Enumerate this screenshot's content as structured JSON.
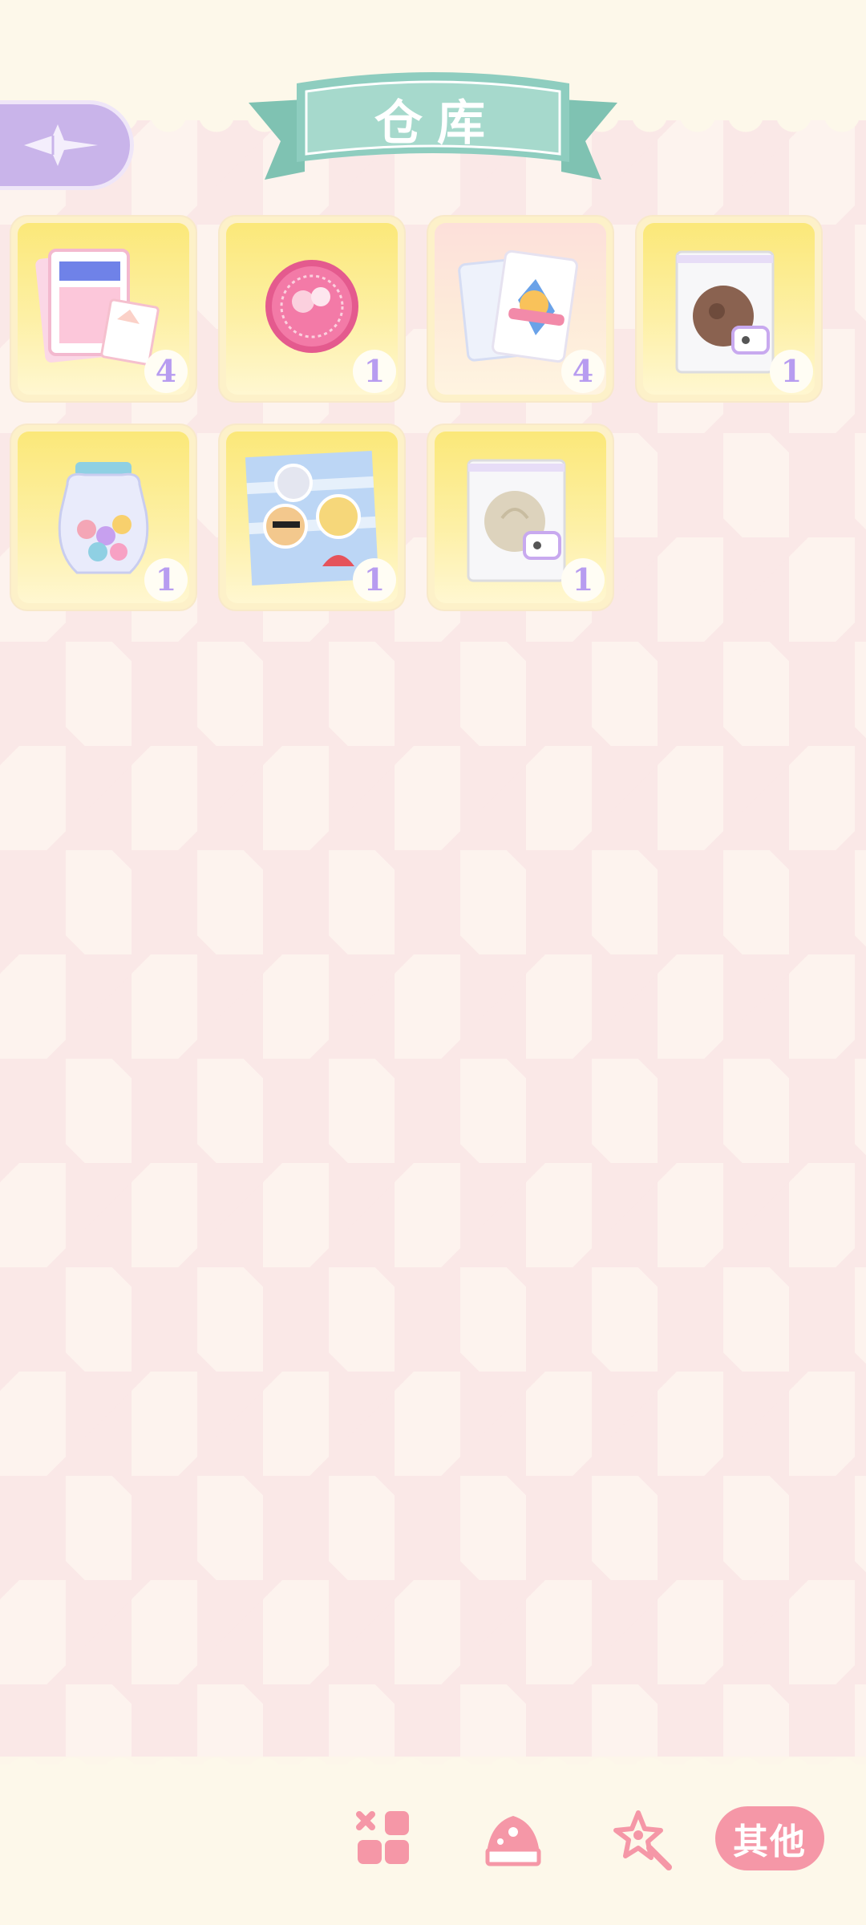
{
  "header": {
    "title": "仓库"
  },
  "colors": {
    "accent_pink": "#f597a7",
    "ribbon_teal": "#8ecdbf",
    "back_button_purple": "#c9b4ea",
    "badge_text": "#b79cf0"
  },
  "items": [
    {
      "name": "photo-card-set",
      "count": "4"
    },
    {
      "name": "pink-badge-pin",
      "count": "1"
    },
    {
      "name": "playing-cards",
      "count": "4"
    },
    {
      "name": "cookie-bag",
      "count": "1"
    },
    {
      "name": "candy-bear-jar",
      "count": "1"
    },
    {
      "name": "sticker-sheet",
      "count": "1"
    },
    {
      "name": "ghost-cookie-bag",
      "count": "1"
    }
  ],
  "nav": {
    "other_label": "其他",
    "icons": [
      "grid-icon",
      "cake-icon",
      "wand-icon"
    ]
  }
}
